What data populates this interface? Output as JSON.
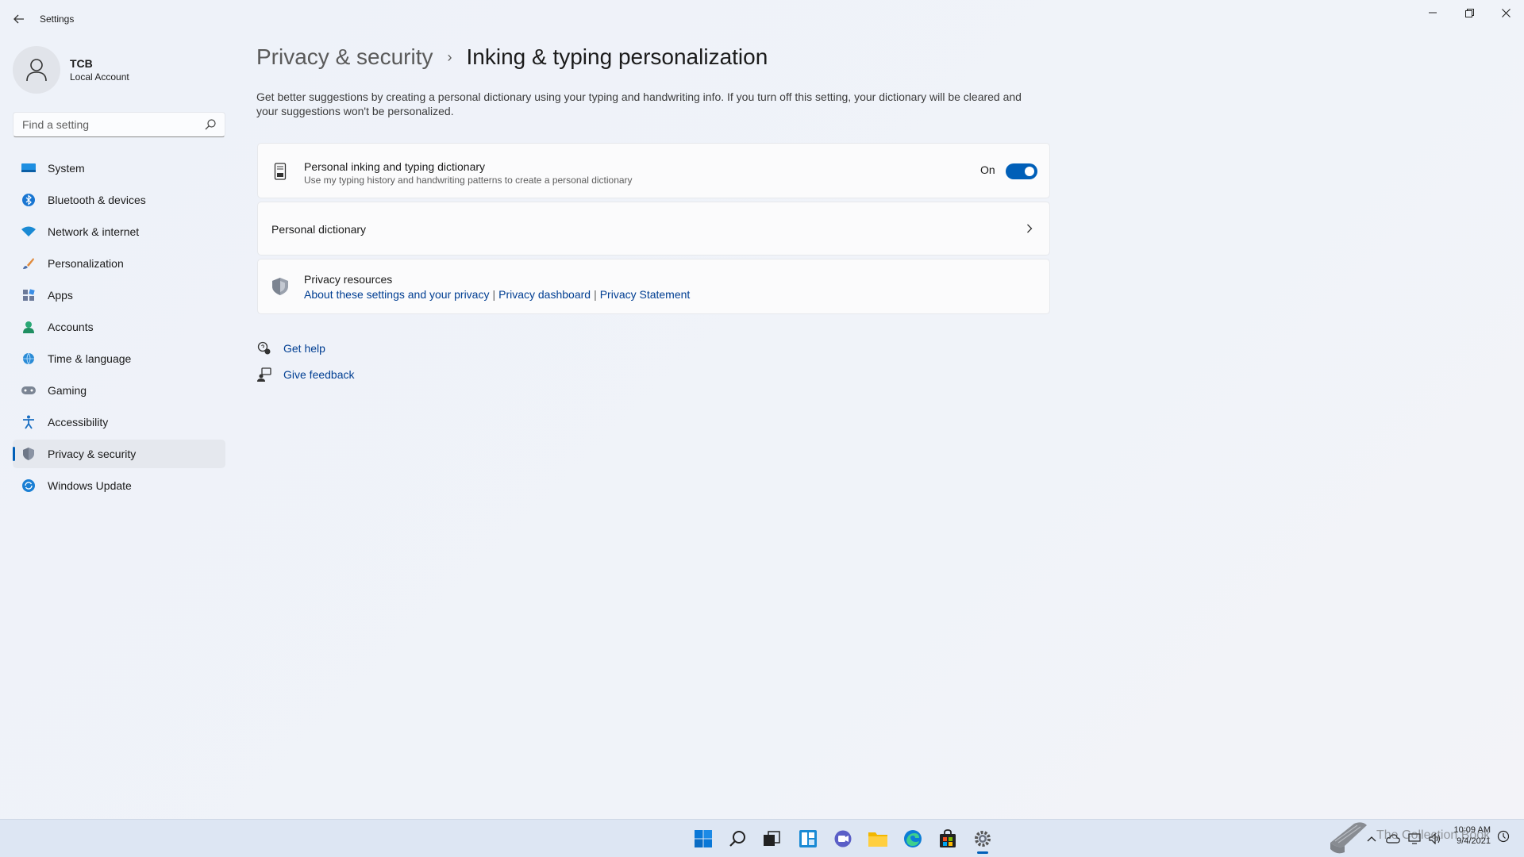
{
  "window": {
    "title": "Settings",
    "back_icon": "back-arrow-icon",
    "controls": [
      "minimize-icon",
      "restore-icon",
      "close-icon"
    ]
  },
  "profile": {
    "name": "TCB",
    "account_type": "Local Account"
  },
  "search": {
    "placeholder": "Find a setting",
    "value": ""
  },
  "sidebar": {
    "items": [
      {
        "label": "System",
        "icon": "system-icon",
        "active": false
      },
      {
        "label": "Bluetooth & devices",
        "icon": "bluetooth-icon",
        "active": false
      },
      {
        "label": "Network & internet",
        "icon": "wifi-icon",
        "active": false
      },
      {
        "label": "Personalization",
        "icon": "brush-icon",
        "active": false
      },
      {
        "label": "Apps",
        "icon": "apps-icon",
        "active": false
      },
      {
        "label": "Accounts",
        "icon": "person-icon",
        "active": false
      },
      {
        "label": "Time & language",
        "icon": "globe-clock-icon",
        "active": false
      },
      {
        "label": "Gaming",
        "icon": "gamepad-icon",
        "active": false
      },
      {
        "label": "Accessibility",
        "icon": "accessibility-icon",
        "active": false
      },
      {
        "label": "Privacy & security",
        "icon": "shield-icon",
        "active": true
      },
      {
        "label": "Windows Update",
        "icon": "update-icon",
        "active": false
      }
    ]
  },
  "header": {
    "parent": "Privacy & security",
    "separator": "›",
    "current": "Inking & typing personalization"
  },
  "description": "Get better suggestions by creating a personal dictionary using your typing and handwriting info. If you turn off this setting, your dictionary will be cleared and your suggestions won't be personalized.",
  "settings": {
    "dictionary_toggle": {
      "title": "Personal inking and typing dictionary",
      "subtitle": "Use my typing history and handwriting patterns to create a personal dictionary",
      "state_label": "On",
      "on": true
    },
    "personal_dictionary": {
      "title": "Personal dictionary"
    },
    "privacy_resources": {
      "title": "Privacy resources",
      "links": [
        "About these settings and your privacy",
        "Privacy dashboard",
        "Privacy Statement"
      ],
      "separator": "|"
    }
  },
  "help": {
    "get_help": "Get help",
    "give_feedback": "Give feedback"
  },
  "taskbar": {
    "apps": [
      "windows-start-icon",
      "search-icon",
      "task-view-icon",
      "widgets-icon",
      "chat-icon",
      "file-explorer-icon",
      "edge-icon",
      "store-icon",
      "settings-icon"
    ],
    "active_app": "settings-icon",
    "time": "10:09 AM",
    "date": "9/4/2021"
  },
  "watermark": {
    "text": "The Collection Book"
  },
  "colors": {
    "accent": "#005fb8",
    "link": "#003e92",
    "background": "#eef2f9",
    "card": "#fbfbfc"
  }
}
